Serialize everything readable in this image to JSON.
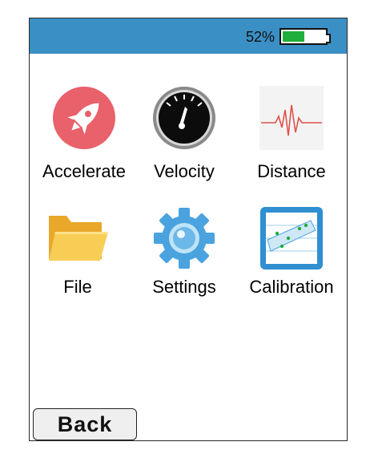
{
  "status": {
    "battery_text": "52%",
    "battery_level": 0.52
  },
  "menu": [
    {
      "label": "Accelerate",
      "icon": "rocket-icon"
    },
    {
      "label": "Velocity",
      "icon": "speedometer-icon"
    },
    {
      "label": "Distance",
      "icon": "waveform-icon"
    },
    {
      "label": "File",
      "icon": "folder-icon"
    },
    {
      "label": "Settings",
      "icon": "gear-icon"
    },
    {
      "label": "Calibration",
      "icon": "calibration-chart-icon"
    }
  ],
  "back_button": {
    "label": "Back"
  },
  "colors": {
    "statusbar": "#3a8fc4",
    "battery_fill": "#1fae3c",
    "rocket": "#e8616b",
    "folder": "#f4c64c",
    "gear": "#4aa3df"
  }
}
